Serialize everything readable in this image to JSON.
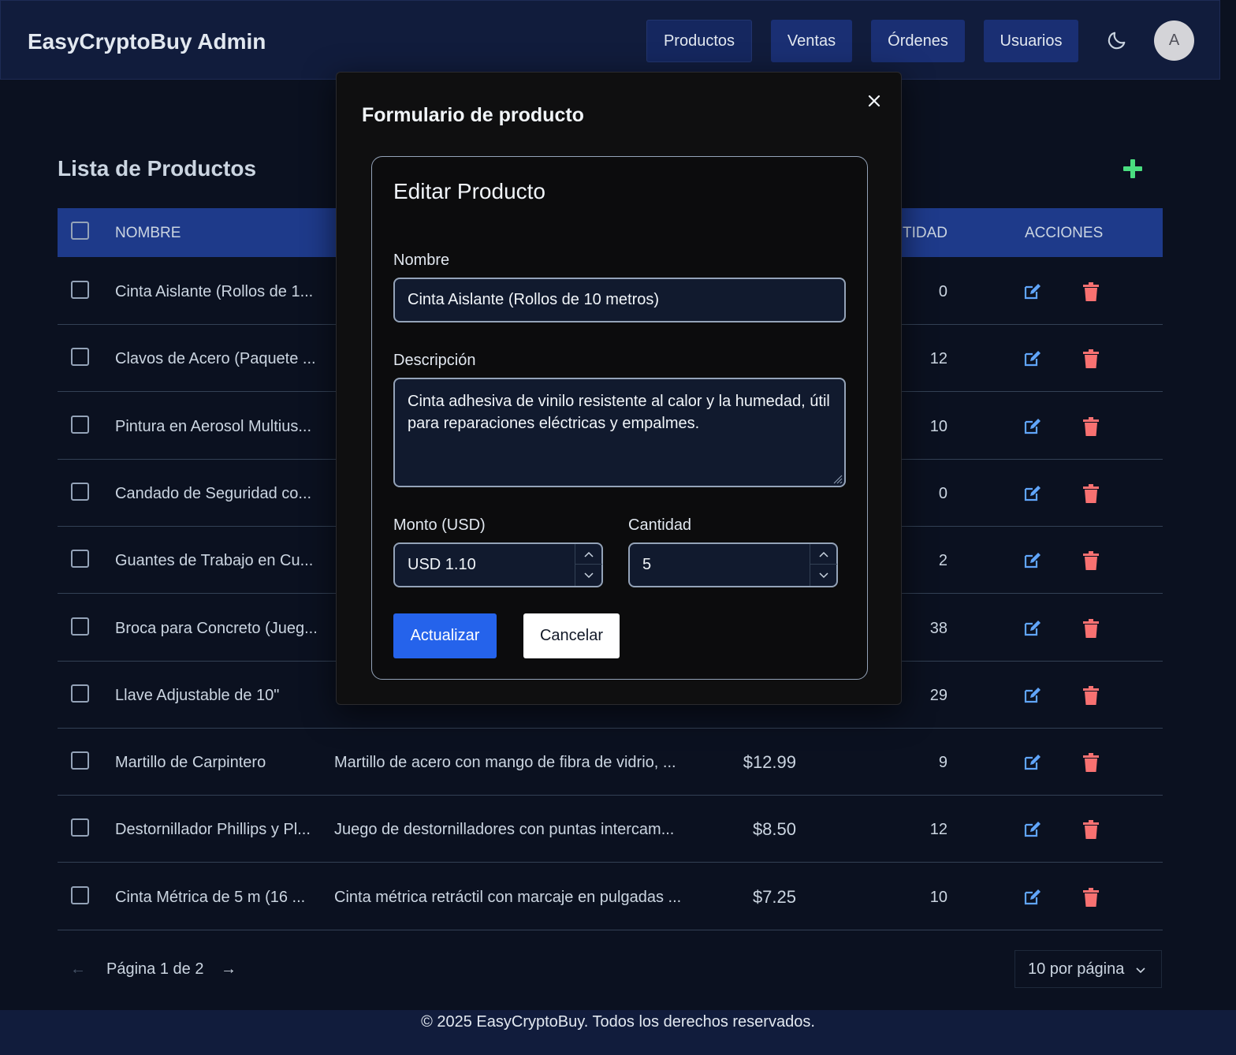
{
  "header": {
    "brand": "EasyCryptoBuy Admin",
    "nav": [
      "Productos",
      "Ventas",
      "Órdenes",
      "Usuarios"
    ],
    "active_nav": "Productos",
    "avatar_initial": "A",
    "theme_icon": "moon-icon"
  },
  "main": {
    "title": "Lista de Productos",
    "add_icon": "plus-icon",
    "columns": {
      "name": "NOMBRE",
      "qty": "TIDAD",
      "actions": "ACCIONES"
    },
    "rows": [
      {
        "name": "Cinta Aislante (Rollos de 1...",
        "desc": "",
        "price": "",
        "qty": "0"
      },
      {
        "name": "Clavos de Acero (Paquete ...",
        "desc": "",
        "price": "",
        "qty": "12"
      },
      {
        "name": "Pintura en Aerosol Multius...",
        "desc": "",
        "price": "",
        "qty": "10"
      },
      {
        "name": "Candado de Seguridad co...",
        "desc": "",
        "price": "",
        "qty": "0"
      },
      {
        "name": "Guantes de Trabajo en Cu...",
        "desc": "",
        "price": "",
        "qty": "2"
      },
      {
        "name": "Broca para Concreto (Jueg...",
        "desc": "",
        "price": "",
        "qty": "38"
      },
      {
        "name": "Llave Adjustable de 10\"",
        "desc": "",
        "price": "",
        "qty": "29"
      },
      {
        "name": "Martillo de Carpintero",
        "desc": "Martillo de acero con mango de fibra de vidrio, ...",
        "price": "$12.99",
        "qty": "9"
      },
      {
        "name": "Destornillador Phillips y Pl...",
        "desc": "Juego de destornilladores con puntas intercam...",
        "price": "$8.50",
        "qty": "12"
      },
      {
        "name": "Cinta Métrica de 5 m (16 ...",
        "desc": "Cinta métrica retráctil con marcaje en pulgadas ...",
        "price": "$7.25",
        "qty": "10"
      }
    ]
  },
  "pagination": {
    "prev": "←",
    "text": "Página 1 de 2",
    "next": "→",
    "per_page": "10 por página"
  },
  "footer": {
    "text": "© 2025 EasyCryptoBuy. Todos los derechos reservados."
  },
  "modal": {
    "title": "Formulario de producto",
    "card_title": "Editar Producto",
    "name_label": "Nombre",
    "name_value": "Cinta Aislante (Rollos de 10 metros)",
    "desc_label": "Descripción",
    "desc_value": "Cinta adhesiva de vinilo resistente al calor y la humedad, útil para reparaciones eléctricas y empalmes.",
    "amount_label": "Monto (USD)",
    "amount_value": "USD 1.10",
    "qty_label": "Cantidad",
    "qty_value": "5",
    "submit_label": "Actualizar",
    "cancel_label": "Cancelar"
  },
  "colors": {
    "header_bg": "#111c3c",
    "table_header_bg": "#1e3a8a",
    "primary": "#2563eb",
    "add_green": "#4ade80",
    "edit_blue": "#60a5fa",
    "delete_red": "#f87171"
  }
}
